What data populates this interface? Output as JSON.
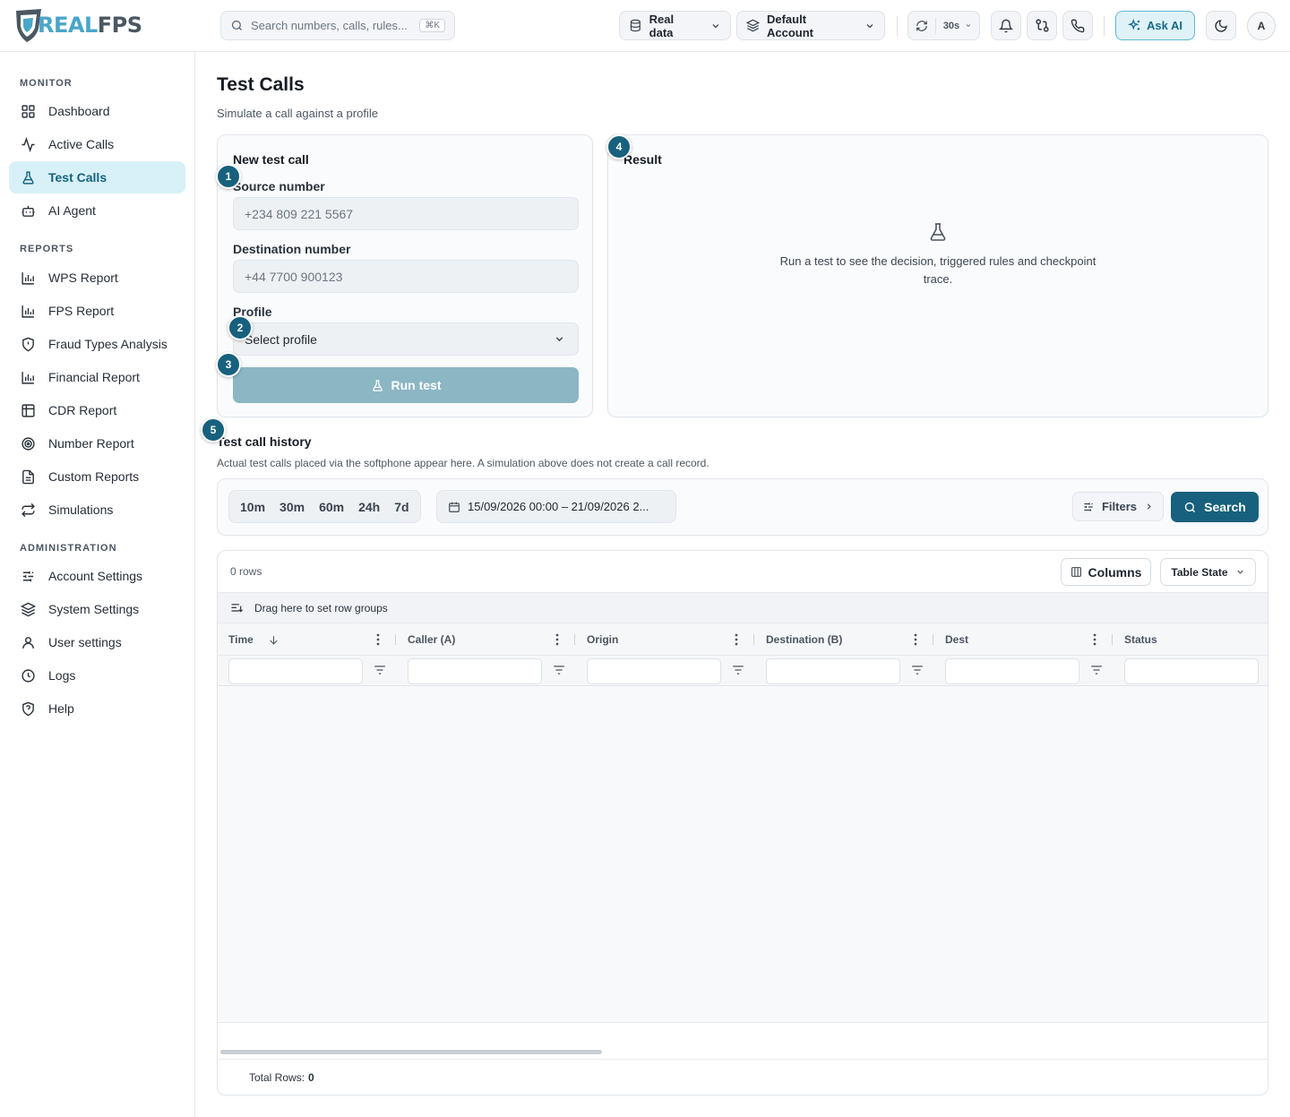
{
  "brand": {
    "logo_real": "REAL",
    "logo_fps": "FPS"
  },
  "topbar": {
    "search_placeholder": "Search numbers, calls, rules...",
    "search_shortcut": "⌘K",
    "data_source": "Real data",
    "account": "Default Account",
    "refresh_interval": "30s",
    "ask_ai": "Ask AI",
    "avatar_initial": "A"
  },
  "sidebar": {
    "monitor_title": "MONITOR",
    "monitor_items": [
      {
        "label": "Dashboard",
        "icon": "dashboard-icon"
      },
      {
        "label": "Active Calls",
        "icon": "activity-icon"
      },
      {
        "label": "Test Calls",
        "icon": "flask-icon",
        "active": true
      },
      {
        "label": "AI Agent",
        "icon": "bot-icon"
      }
    ],
    "reports_title": "REPORTS",
    "reports_items": [
      {
        "label": "WPS Report",
        "icon": "bar-chart-icon"
      },
      {
        "label": "FPS Report",
        "icon": "bar-chart-icon"
      },
      {
        "label": "Fraud Types Analysis",
        "icon": "shield-alert-icon"
      },
      {
        "label": "Financial Report",
        "icon": "bar-chart-icon"
      },
      {
        "label": "CDR Report",
        "icon": "table-icon"
      },
      {
        "label": "Number Report",
        "icon": "target-icon"
      },
      {
        "label": "Custom Reports",
        "icon": "file-icon"
      },
      {
        "label": "Simulations",
        "icon": "repeat-icon"
      }
    ],
    "admin_title": "ADMINISTRATION",
    "admin_items": [
      {
        "label": "Account Settings",
        "icon": "sliders-icon"
      },
      {
        "label": "System Settings",
        "icon": "layers-icon"
      },
      {
        "label": "User settings",
        "icon": "user-icon"
      },
      {
        "label": "Logs",
        "icon": "clock-icon"
      },
      {
        "label": "Help",
        "icon": "help-shield-icon"
      }
    ]
  },
  "page": {
    "title": "Test Calls",
    "subtitle": "Simulate a call against a profile"
  },
  "new_test": {
    "title": "New test call",
    "source_label": "Source number",
    "source_placeholder": "+234 809 221 5567",
    "dest_label": "Destination number",
    "dest_placeholder": "+44 7700 900123",
    "profile_label": "Profile",
    "profile_value": "Select profile",
    "run_label": "Run test"
  },
  "result": {
    "title": "Result",
    "empty_text": "Run a test to see the decision, triggered rules and checkpoint trace."
  },
  "badges": [
    "1",
    "2",
    "3",
    "4",
    "5"
  ],
  "history": {
    "title": "Test call history",
    "subtitle": "Actual test calls placed via the softphone appear here. A simulation above does not create a call record.",
    "ranges": [
      "10m",
      "30m",
      "60m",
      "24h",
      "7d"
    ],
    "date_range": "15/09/2026 00:00 – 21/09/2026 2...",
    "filters_label": "Filters",
    "search_label": "Search"
  },
  "grid": {
    "rows_count": "0 rows",
    "columns_label": "Columns",
    "table_state_label": "Table State",
    "group_hint": "Drag here to set row groups",
    "columns": [
      "Time",
      "Caller (A)",
      "Origin",
      "Destination (B)",
      "Dest",
      "Status"
    ],
    "footer_label": "Total Rows:",
    "footer_value": "0"
  },
  "colors": {
    "accent": "#17617e",
    "active_nav_bg": "#d8f0f8",
    "run_disabled": "#8bb6c4",
    "ask_ai_bg": "#dff2f8"
  }
}
